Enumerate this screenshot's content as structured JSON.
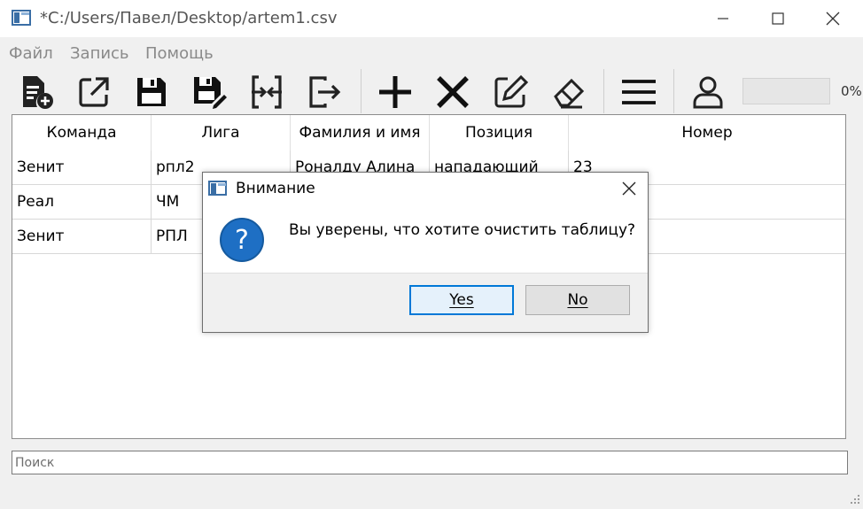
{
  "window": {
    "title": "*C:/Users/Павел/Desktop/artem1.csv"
  },
  "menubar": {
    "items": [
      {
        "label": "Файл"
      },
      {
        "label": "Запись"
      },
      {
        "label": "Помощь"
      }
    ]
  },
  "toolbar": {
    "buttons": [
      {
        "icon": "new-file-icon"
      },
      {
        "icon": "open-external-icon"
      },
      {
        "icon": "save-icon"
      },
      {
        "icon": "save-as-icon"
      },
      {
        "icon": "merge-icon"
      },
      {
        "icon": "exit-icon"
      },
      {
        "icon": "add-icon"
      },
      {
        "icon": "delete-icon"
      },
      {
        "icon": "edit-icon"
      },
      {
        "icon": "eraser-icon"
      },
      {
        "icon": "menu-icon"
      },
      {
        "icon": "user-icon"
      }
    ],
    "progress": {
      "value": 0,
      "label": "0%"
    }
  },
  "table": {
    "columns": [
      "Команда",
      "Лига",
      "Фамилия и имя",
      "Позиция",
      "Номер"
    ],
    "rows": [
      [
        "Зенит",
        "рпл2",
        "Роналду Алина",
        "нападающий",
        "23"
      ],
      [
        "Реал",
        "ЧМ",
        "",
        "",
        ""
      ],
      [
        "Зенит",
        "РПЛ",
        "",
        "",
        ""
      ]
    ]
  },
  "search": {
    "placeholder": "Поиск",
    "value": ""
  },
  "dialog": {
    "title": "Внимание",
    "message": "Вы уверены, что хотите очистить таблицу?",
    "icon": "question-icon",
    "buttons": {
      "yes": "Yes",
      "no": "No"
    },
    "accent": "#0078d7"
  }
}
